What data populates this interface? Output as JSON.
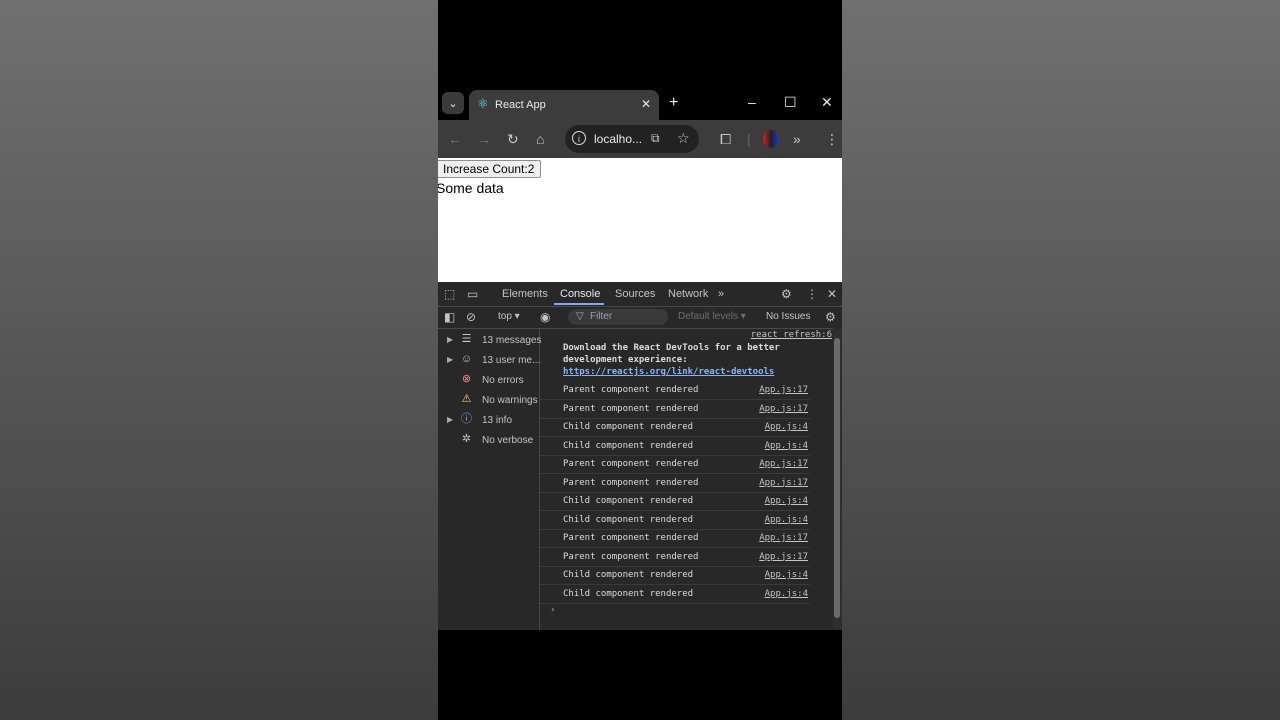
{
  "browser": {
    "tab_title": "React App",
    "url": "localho...",
    "icons": {
      "tab_search": "chevron-down-icon",
      "favicon": "react-icon",
      "close": "close-icon",
      "new_tab": "plus-icon",
      "back": "back-arrow-icon",
      "forward": "forward-arrow-icon",
      "reload": "reload-icon",
      "home": "home-icon",
      "site_info": "info-icon",
      "install": "install-icon",
      "bookmark": "star-icon",
      "extensions": "puzzle-icon",
      "more": "chevron-double-right-icon",
      "menu": "kebab-menu-icon"
    }
  },
  "page": {
    "button_label": "Increase Count:2",
    "text": "Some data"
  },
  "devtools": {
    "tabs": [
      "Elements",
      "Console",
      "Sources",
      "Network"
    ],
    "active_tab": "Console",
    "context": "top",
    "filter_placeholder": "Filter",
    "levels": "Default levels",
    "issues": "No Issues",
    "sidebar": [
      {
        "label": "13 messages",
        "icon": "list-icon",
        "expandable": true
      },
      {
        "label": "13 user me...",
        "icon": "user-icon",
        "expandable": true
      },
      {
        "label": "No errors",
        "icon": "error-icon",
        "expandable": false
      },
      {
        "label": "No warnings",
        "icon": "warning-icon",
        "expandable": false
      },
      {
        "label": "13 info",
        "icon": "info-icon",
        "expandable": true
      },
      {
        "label": "No verbose",
        "icon": "bug-icon",
        "expandable": false
      }
    ],
    "console": {
      "first_source": "react_refresh:6",
      "devtools_msg_line1": "Download the React DevTools for a better",
      "devtools_msg_line2": "development experience:",
      "devtools_link": "https://reactjs.org/link/react-devtools",
      "messages": [
        {
          "text": "Parent component rendered",
          "src": "App.js:17"
        },
        {
          "text": "Parent component rendered",
          "src": "App.js:17"
        },
        {
          "text": "Child component rendered",
          "src": "App.js:4"
        },
        {
          "text": "Child component rendered",
          "src": "App.js:4"
        },
        {
          "text": "Parent component rendered",
          "src": "App.js:17"
        },
        {
          "text": "Parent component rendered",
          "src": "App.js:17"
        },
        {
          "text": "Child component rendered",
          "src": "App.js:4"
        },
        {
          "text": "Child component rendered",
          "src": "App.js:4"
        },
        {
          "text": "Parent component rendered",
          "src": "App.js:17"
        },
        {
          "text": "Parent component rendered",
          "src": "App.js:17"
        },
        {
          "text": "Child component rendered",
          "src": "App.js:4"
        },
        {
          "text": "Child component rendered",
          "src": "App.js:4"
        }
      ],
      "prompt": "›"
    }
  },
  "colors": {
    "accent": "#7cacf8",
    "error": "#f28b82",
    "warning": "#fdd663",
    "info": "#8ab4f8"
  }
}
